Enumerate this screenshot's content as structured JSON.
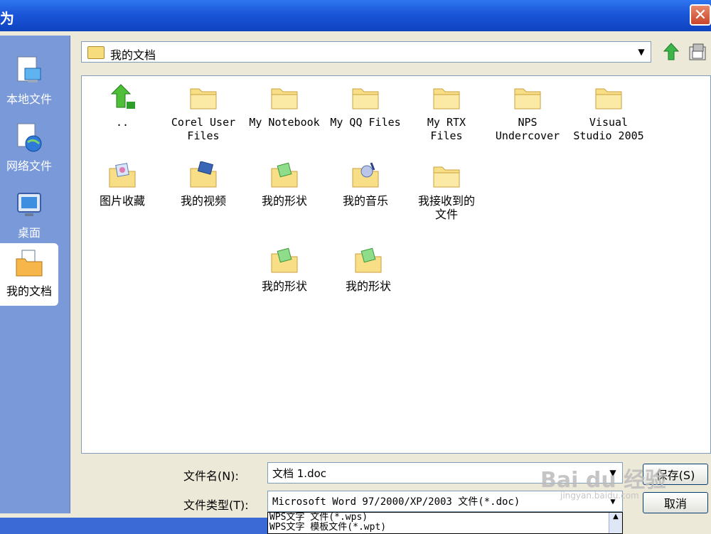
{
  "window": {
    "title": "为",
    "close_glyph": "✕"
  },
  "places": [
    {
      "label": "本地文件",
      "icon": "computer-icon"
    },
    {
      "label": "网络文件",
      "icon": "network-globe-icon"
    },
    {
      "label": "桌面",
      "icon": "desktop-icon"
    },
    {
      "label": "我的文档",
      "icon": "documents-folder-icon",
      "selected": true
    }
  ],
  "location": {
    "value": "我的文档",
    "dropdown_glyph": "▼"
  },
  "toolbar": {
    "up_icon": "up-folder-icon",
    "new_folder_icon": "new-folder-icon"
  },
  "files": [
    {
      "label": "..",
      "icon": "up-arrow-icon"
    },
    {
      "label": "Corel User\nFiles",
      "icon": "folder-icon"
    },
    {
      "label": "My Notebook",
      "icon": "folder-icon"
    },
    {
      "label": "My QQ Files",
      "icon": "folder-icon"
    },
    {
      "label": "My RTX\nFiles",
      "icon": "folder-icon"
    },
    {
      "label": "NPS\nUndercover",
      "icon": "folder-icon"
    },
    {
      "label": "Visual\nStudio 2005",
      "icon": "folder-icon"
    },
    {
      "label": "图片收藏",
      "icon": "pictures-folder-icon"
    },
    {
      "label": "我的视频",
      "icon": "videos-folder-icon"
    },
    {
      "label": "我的形状",
      "icon": "shapes-folder-icon"
    },
    {
      "label": "我的音乐",
      "icon": "music-folder-icon"
    },
    {
      "label": "我接收到的\n文件",
      "icon": "folder-icon"
    },
    {
      "label": "我的形状",
      "icon": "shapes-folder-icon"
    },
    {
      "label": "我的形状",
      "icon": "shapes-folder-icon"
    }
  ],
  "form": {
    "filename_label": "文件名(N):",
    "filename_value": "文档 1.doc",
    "filetype_label": "文件类型(T):",
    "filetype_value": "Microsoft Word 97/2000/XP/2003 文件(*.doc)",
    "filetype_options": [
      "WPS文字 文件(*.wps)",
      "WPS文字 模板文件(*.wpt)"
    ],
    "save_button": "保存(S)",
    "cancel_button": "取消"
  },
  "watermark": {
    "text": "Bai du 经验",
    "sub": "jingyan.baidu.com"
  },
  "colors": {
    "title_bar": "#1a55d8",
    "places_bar": "#7a99d9",
    "folder": "#f6dc7c"
  }
}
